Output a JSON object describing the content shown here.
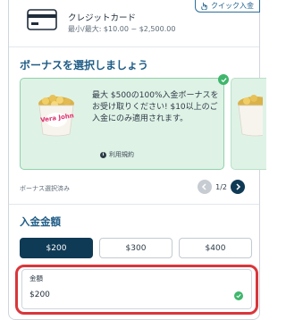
{
  "payment_method": {
    "icon": "credit-card-icon",
    "title": "クレジットカード",
    "limits": "最小/最大: $10.00 ~ $2,500.00",
    "quick_badge": "クイック入金"
  },
  "bonus": {
    "heading": "ボーナスを選択しましょう",
    "card": {
      "logo_text": "Vera John",
      "description": "最大 $500の100%入金ボーナスをお受け取りください! $10以上のご入金にのみ適用されます。",
      "terms_link": "利用規約",
      "selected": true
    },
    "selected_label": "ボーナス選択済み",
    "pager": {
      "current": 1,
      "total": 2,
      "text": "1/2"
    }
  },
  "deposit": {
    "heading": "入金金額",
    "quick_amounts": [
      "$200",
      "$300",
      "$400"
    ],
    "selected_amount": "$200",
    "amount_field": {
      "label": "金額",
      "value": "$200",
      "valid": true
    }
  },
  "colors": {
    "heading": "#1f5c86",
    "primary": "#0f3a55",
    "bonus_bg": "#dff2e6",
    "success": "#3fb66c",
    "highlight": "#d9363b"
  }
}
